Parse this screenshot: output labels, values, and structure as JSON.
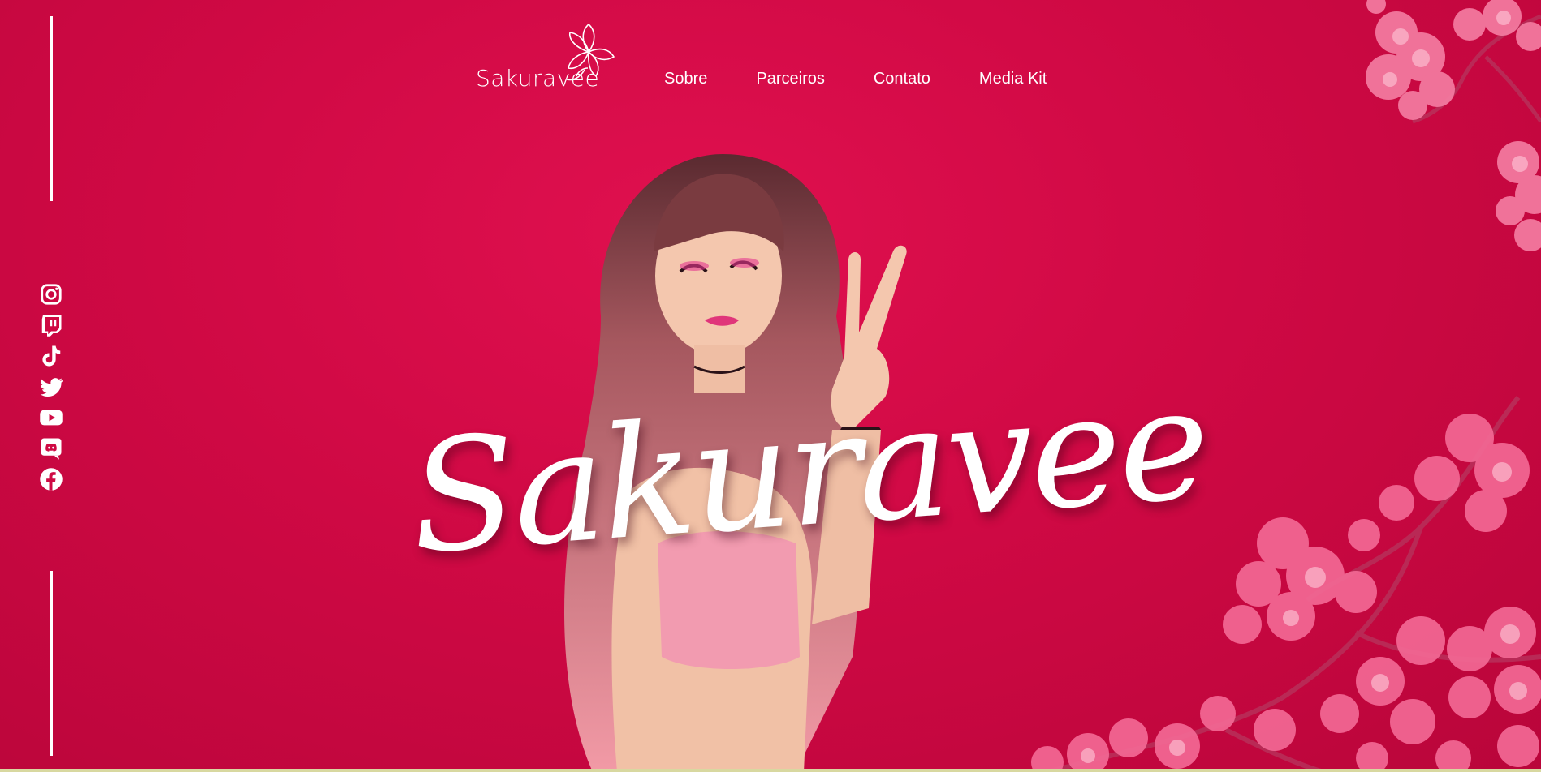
{
  "logo": {
    "text": "Sakuravee",
    "icon": "cherry-blossom-logo-icon"
  },
  "nav": {
    "items": [
      {
        "label": "Sobre"
      },
      {
        "label": "Parceiros"
      },
      {
        "label": "Contato"
      },
      {
        "label": "Media Kit"
      }
    ]
  },
  "social": {
    "icons": [
      "instagram-icon",
      "twitch-icon",
      "tiktok-icon",
      "twitter-icon",
      "youtube-icon",
      "discord-icon",
      "facebook-icon"
    ]
  },
  "hero": {
    "title": "Sakuravee"
  },
  "colors": {
    "background": "#cf0a44",
    "blossom": "#f06a95",
    "text": "#ffffff"
  }
}
